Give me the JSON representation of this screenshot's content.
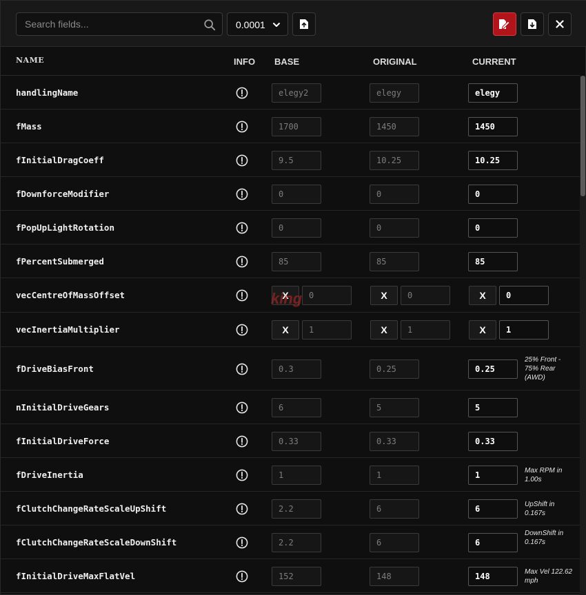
{
  "toolbar": {
    "search_placeholder": "Search fields...",
    "precision_value": "0.0001",
    "icons": [
      "search-icon",
      "chevron-down-icon",
      "file-upload-icon",
      "edit-file-icon",
      "file-download-icon",
      "close-icon"
    ],
    "accent_color": "#b1151b"
  },
  "headers": {
    "name": "NAME",
    "info": "INFO",
    "base": "BASE",
    "original": "ORIGINAL",
    "current": "CURRENT"
  },
  "rows": [
    {
      "name": "handlingName",
      "base": "elegy2",
      "original": "elegy",
      "current": "elegy"
    },
    {
      "name": "fMass",
      "base": "1700",
      "original": "1450",
      "current": "1450"
    },
    {
      "name": "fInitialDragCoeff",
      "base": "9.5",
      "original": "10.25",
      "current": "10.25"
    },
    {
      "name": "fDownforceModifier",
      "base": "0",
      "original": "0",
      "current": "0"
    },
    {
      "name": "fPopUpLightRotation",
      "base": "0",
      "original": "0",
      "current": "0"
    },
    {
      "name": "fPercentSubmerged",
      "base": "85",
      "original": "85",
      "current": "85"
    },
    {
      "name": "vecCentreOfMassOffset",
      "axis": "X",
      "base": "0",
      "original": "0",
      "current": "0"
    },
    {
      "name": "vecInertiaMultiplier",
      "axis": "X",
      "base": "1",
      "original": "1",
      "current": "1"
    },
    {
      "name": "fDriveBiasFront",
      "base": "0.3",
      "original": "0.25",
      "current": "0.25",
      "note": "25% Front - 75% Rear (AWD)"
    },
    {
      "name": "nInitialDriveGears",
      "base": "6",
      "original": "5",
      "current": "5"
    },
    {
      "name": "fInitialDriveForce",
      "base": "0.33",
      "original": "0.33",
      "current": "0.33"
    },
    {
      "name": "fDriveInertia",
      "base": "1",
      "original": "1",
      "current": "1",
      "note": "Max RPM in 1.00s"
    },
    {
      "name": "fClutchChangeRateScaleUpShift",
      "base": "2.2",
      "original": "6",
      "current": "6",
      "note": "UpShift in 0.167s"
    },
    {
      "name": "fClutchChangeRateScaleDownShift",
      "base": "2.2",
      "original": "6",
      "current": "6",
      "note": "DownShift in 0.167s"
    },
    {
      "name": "fInitialDriveMaxFlatVel",
      "base": "152",
      "original": "148",
      "current": "148",
      "note": "Max Vel 122.62 mph"
    }
  ],
  "watermark": "king"
}
